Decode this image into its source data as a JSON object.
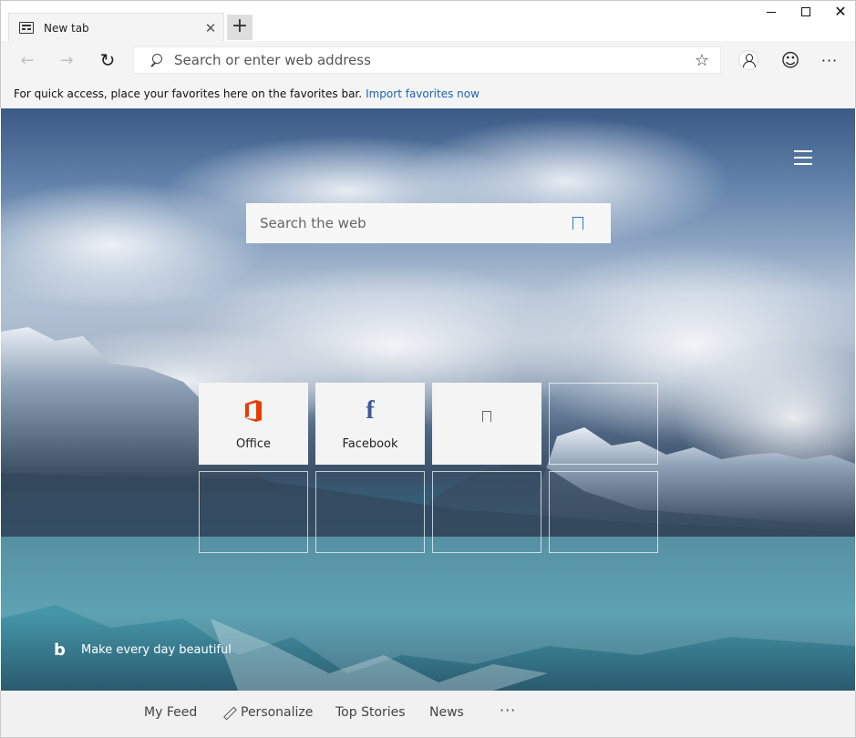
{
  "tab": {
    "title": "New tab",
    "icon": "newtab-page-icon"
  },
  "window_controls": {
    "minimize": "minimize-icon",
    "maximize": "maximize-icon",
    "close": "close-icon"
  },
  "address_bar": {
    "placeholder": "Search or enter web address",
    "value": ""
  },
  "favorites_bar": {
    "message": "For quick access, place your favorites here on the favorites bar.",
    "link": "Import favorites now"
  },
  "newtab": {
    "search_placeholder": "Search the web",
    "tiles": [
      {
        "label": "Office",
        "icon": "office-icon"
      },
      {
        "label": "Facebook",
        "icon": "facebook-icon"
      },
      {
        "label": "",
        "icon": "generic-site-icon"
      }
    ],
    "empty_tiles": 5,
    "bing_tagline": "Make every day beautiful"
  },
  "feed": {
    "items": [
      "My Feed",
      "Personalize",
      "Top Stories",
      "News"
    ],
    "more": "···"
  },
  "colors": {
    "accent": "#1a64b4",
    "office": "#eb3c00",
    "facebook": "#3b5998"
  }
}
